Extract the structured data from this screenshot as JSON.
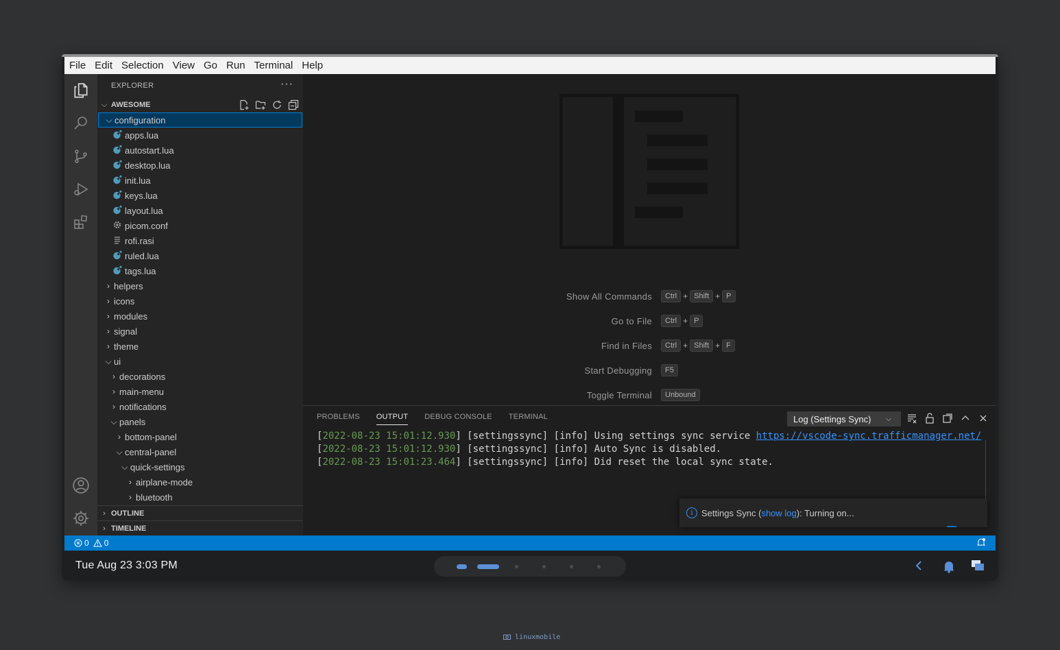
{
  "menu": [
    "File",
    "Edit",
    "Selection",
    "View",
    "Go",
    "Run",
    "Terminal",
    "Help"
  ],
  "sidebar": {
    "title": "EXPLORER",
    "more": "···",
    "root": "AWESOME",
    "tree": [
      {
        "label": "configuration",
        "depth": 0,
        "type": "folder",
        "open": true,
        "selected": true
      },
      {
        "label": "apps.lua",
        "depth": 1,
        "type": "lua"
      },
      {
        "label": "autostart.lua",
        "depth": 1,
        "type": "lua"
      },
      {
        "label": "desktop.lua",
        "depth": 1,
        "type": "lua"
      },
      {
        "label": "init.lua",
        "depth": 1,
        "type": "lua"
      },
      {
        "label": "keys.lua",
        "depth": 1,
        "type": "lua"
      },
      {
        "label": "layout.lua",
        "depth": 1,
        "type": "lua"
      },
      {
        "label": "picom.conf",
        "depth": 1,
        "type": "conf"
      },
      {
        "label": "rofi.rasi",
        "depth": 1,
        "type": "text"
      },
      {
        "label": "ruled.lua",
        "depth": 1,
        "type": "lua"
      },
      {
        "label": "tags.lua",
        "depth": 1,
        "type": "lua"
      },
      {
        "label": "helpers",
        "depth": 0,
        "type": "folder",
        "open": false
      },
      {
        "label": "icons",
        "depth": 0,
        "type": "folder",
        "open": false
      },
      {
        "label": "modules",
        "depth": 0,
        "type": "folder",
        "open": false
      },
      {
        "label": "signal",
        "depth": 0,
        "type": "folder",
        "open": false
      },
      {
        "label": "theme",
        "depth": 0,
        "type": "folder",
        "open": false
      },
      {
        "label": "ui",
        "depth": 0,
        "type": "folder",
        "open": true
      },
      {
        "label": "decorations",
        "depth": 1,
        "type": "folder",
        "open": false
      },
      {
        "label": "main-menu",
        "depth": 1,
        "type": "folder",
        "open": false
      },
      {
        "label": "notifications",
        "depth": 1,
        "type": "folder",
        "open": false
      },
      {
        "label": "panels",
        "depth": 1,
        "type": "folder",
        "open": true
      },
      {
        "label": "bottom-panel",
        "depth": 2,
        "type": "folder",
        "open": false
      },
      {
        "label": "central-panel",
        "depth": 2,
        "type": "folder",
        "open": true
      },
      {
        "label": "quick-settings",
        "depth": 3,
        "type": "folder",
        "open": true
      },
      {
        "label": "airplane-mode",
        "depth": 4,
        "type": "folder",
        "open": false
      },
      {
        "label": "bluetooth",
        "depth": 4,
        "type": "folder",
        "open": false
      }
    ],
    "outline": "OUTLINE",
    "timeline": "TIMELINE"
  },
  "editor": {
    "commands": [
      {
        "label": "Show All Commands",
        "keys": [
          "Ctrl",
          "+",
          "Shift",
          "+",
          "P"
        ]
      },
      {
        "label": "Go to File",
        "keys": [
          "Ctrl",
          "+",
          "P"
        ]
      },
      {
        "label": "Find in Files",
        "keys": [
          "Ctrl",
          "+",
          "Shift",
          "+",
          "F"
        ]
      },
      {
        "label": "Start Debugging",
        "keys": [
          "F5"
        ]
      },
      {
        "label": "Toggle Terminal",
        "keys": [
          "Unbound"
        ]
      }
    ]
  },
  "panel": {
    "tabs": [
      "PROBLEMS",
      "OUTPUT",
      "DEBUG CONSOLE",
      "TERMINAL"
    ],
    "active_tab": "OUTPUT",
    "log_source": "Log (Settings Sync)",
    "lines": [
      {
        "ts": "2022-08-23 15:01:12.930",
        "src": "settingssync",
        "level": "info",
        "msg": "Using settings sync service ",
        "link": "https://vscode-sync.trafficmanager.net/"
      },
      {
        "ts": "2022-08-23 15:01:12.930",
        "src": "settingssync",
        "level": "info",
        "msg": "Auto Sync is disabled.",
        "link": ""
      },
      {
        "ts": "2022-08-23 15:01:23.464",
        "src": "settingssync",
        "level": "info",
        "msg": "Did reset the local sync state.",
        "link": ""
      }
    ]
  },
  "toast": {
    "prefix": "Settings Sync ",
    "open": "(",
    "link": "show log",
    "close": ")",
    "suffix": ": Turning on..."
  },
  "status": {
    "errors": "0",
    "warnings": "0"
  },
  "dock": {
    "clock": "Tue Aug 23  3:03 PM"
  },
  "caption": "linuxmobile",
  "colors": {
    "accent": "#007acc",
    "selection": "#04395e",
    "lua_icon": "#519aba",
    "timestamp": "#6a9955",
    "link": "#3794ff"
  }
}
